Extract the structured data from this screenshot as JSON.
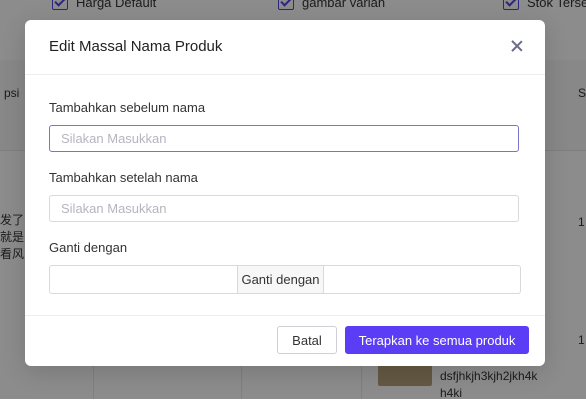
{
  "background": {
    "checkboxes": [
      "Harga Default",
      "gambar varian",
      "Stok Tersedia"
    ],
    "header_cols": [
      "psi",
      "S"
    ],
    "row_text_lines": [
      "发了",
      "就是",
      "看风"
    ],
    "row_nums": [
      "1",
      "1"
    ],
    "sku_lines": [
      "dsfjhkjh3kjh2jkh4k",
      "h4ki"
    ]
  },
  "modal": {
    "title": "Edit Massal Nama Produk",
    "before_label": "Tambahkan sebelum nama",
    "before_placeholder": "Silakan Masukkan",
    "after_label": "Tambahkan setelah nama",
    "after_placeholder": "Silakan Masukkan",
    "replace_label": "Ganti dengan",
    "replace_addon": "Ganti dengan",
    "cancel_label": "Batal",
    "apply_label": "Terapkan ke semua produk"
  },
  "colors": {
    "accent": "#5b3df5",
    "overlay": "rgba(0,0,0,0.45)"
  }
}
